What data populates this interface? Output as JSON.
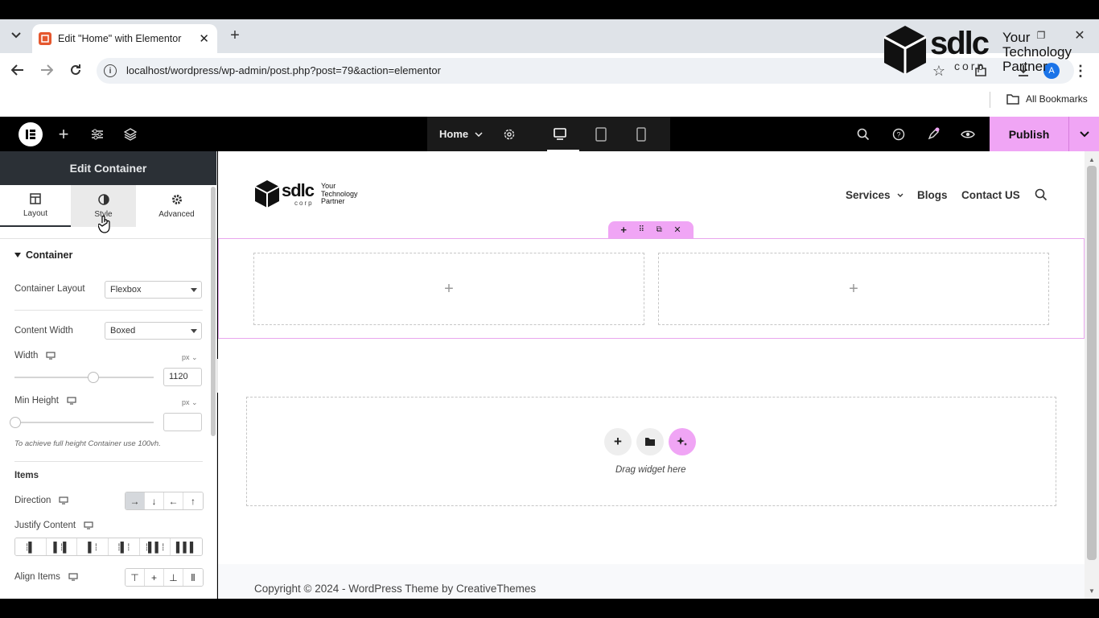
{
  "browser": {
    "tab_title": "Edit \"Home\" with Elementor",
    "url": "localhost/wordpress/wp-admin/post.php?post=79&action=elementor",
    "bookmarks_label": "All Bookmarks",
    "profile_initial": "A"
  },
  "watermark": {
    "brand": "sdlc",
    "sub": "corp",
    "tagline_1": "Your",
    "tagline_2": "Technology",
    "tagline_3": "Partner"
  },
  "editor_bar": {
    "page_name": "Home",
    "publish_label": "Publish",
    "accent": "#f0a5f5"
  },
  "panel": {
    "title": "Edit Container",
    "tabs": [
      "Layout",
      "Style",
      "Advanced"
    ],
    "section_title": "Container",
    "container_layout_label": "Container Layout",
    "container_layout_value": "Flexbox",
    "content_width_label": "Content Width",
    "content_width_value": "Boxed",
    "width_label": "Width",
    "width_unit": "px",
    "width_value": "1120",
    "min_height_label": "Min Height",
    "min_height_unit": "px",
    "min_height_value": "",
    "hint": "To achieve full height Container use 100vh.",
    "items_heading": "Items",
    "direction_label": "Direction",
    "justify_label": "Justify Content",
    "align_label": "Align Items"
  },
  "site": {
    "logo_brand": "sdlc",
    "logo_sub": "corp",
    "logo_tag_1": "Your",
    "logo_tag_2": "Technology",
    "logo_tag_3": "Partner",
    "nav": [
      "Services",
      "Blogs",
      "Contact US"
    ],
    "drag_text": "Drag widget here",
    "footer": "Copyright © 2024 - WordPress Theme by CreativeThemes"
  }
}
